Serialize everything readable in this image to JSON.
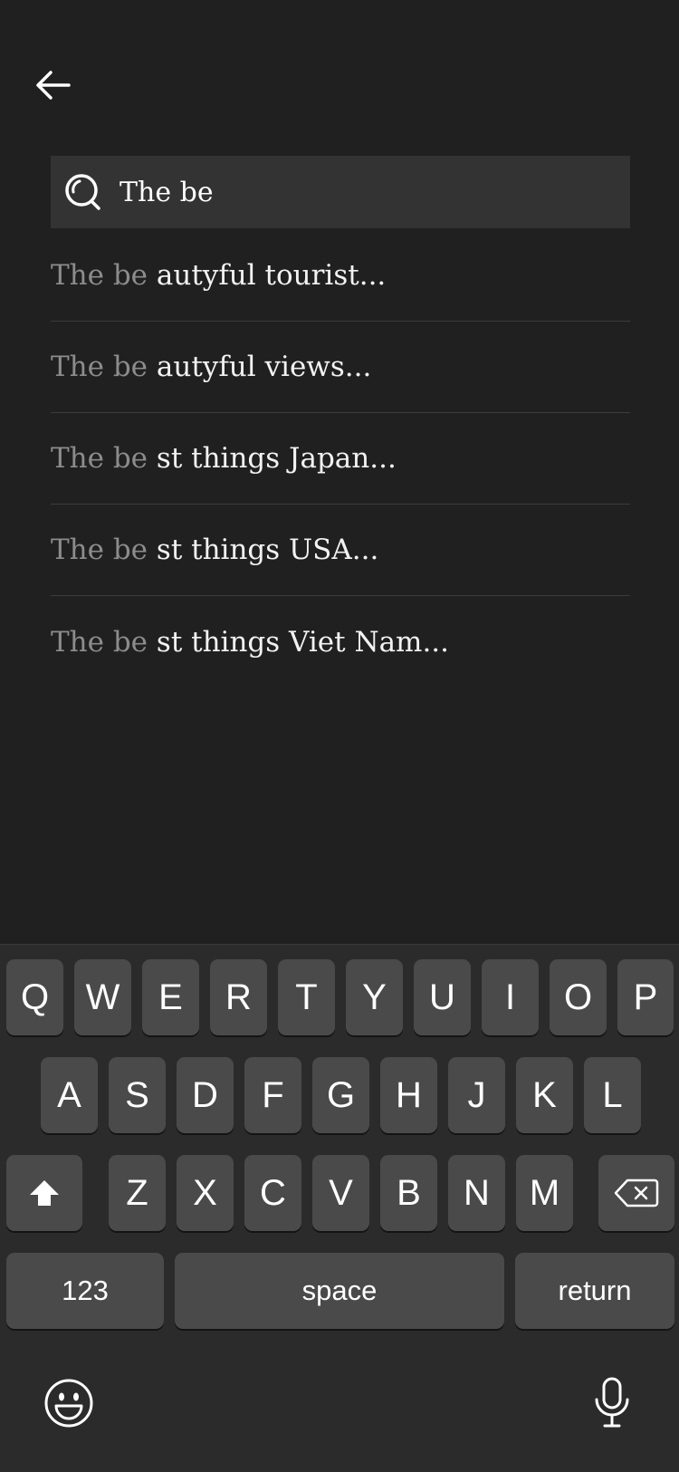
{
  "search": {
    "value": "The be"
  },
  "suggestions": [
    {
      "typed": "The be",
      "completion": "autyful tourist..."
    },
    {
      "typed": "The be",
      "completion": "autyful views..."
    },
    {
      "typed": "The be",
      "completion": "st things Japan..."
    },
    {
      "typed": "The be",
      "completion": "st things USA..."
    },
    {
      "typed": "The be",
      "completion": "st things Viet Nam..."
    }
  ],
  "keyboard": {
    "row1": [
      "Q",
      "W",
      "E",
      "R",
      "T",
      "Y",
      "U",
      "I",
      "O",
      "P"
    ],
    "row2": [
      "A",
      "S",
      "D",
      "F",
      "G",
      "H",
      "J",
      "K",
      "L"
    ],
    "row3": [
      "Z",
      "X",
      "C",
      "V",
      "B",
      "N",
      "M"
    ],
    "numbers_label": "123",
    "space_label": "space",
    "return_label": "return",
    "shift_icon": "shift-icon",
    "delete_icon": "backspace-icon",
    "emoji_icon": "emoji-icon",
    "mic_icon": "microphone-icon"
  },
  "colors": {
    "background": "#202020",
    "search_field": "#333333",
    "typed_text": "#8c8c8c",
    "key": "#4a4a4a",
    "keyboard_bg": "#2b2b2b"
  }
}
